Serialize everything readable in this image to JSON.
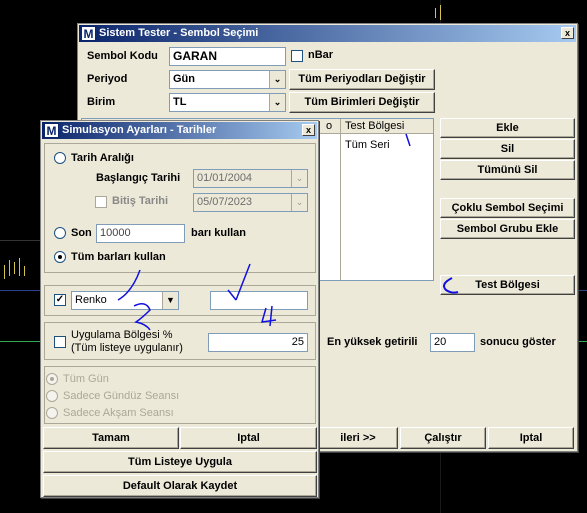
{
  "main_window": {
    "title": "Sistem Tester - Sembol Seçimi",
    "close": "x",
    "sembol_label": "Sembol Kodu",
    "sembol_value": "GARAN",
    "nbar_label": "nBar",
    "periyod_label": "Periyod",
    "periyod_value": "Gün",
    "tum_periyod_button": "Tüm Periyodları Değiştir",
    "birim_label": "Birim",
    "birim_value": "TL",
    "tum_birim_button": "Tüm Birimleri Değiştir",
    "grid_header_partial": "o",
    "grid_header": "Test Bölgesi",
    "grid_row": "Tüm Seri",
    "ekle_button": "Ekle",
    "sil_button": "Sil",
    "tumunu_sil_button": "Tümünü Sil",
    "coklu_button": "Çoklu Sembol Seçimi",
    "grup_button": "Sembol Grubu Ekle",
    "test_bolgesi_button": "Test Bölgesi",
    "en_yuksek_label": "En yüksek getirili",
    "en_yuksek_value": "20",
    "sonucu_label": "sonucu göster",
    "ileri_button": "ileri >>",
    "calistir_button": "Çalıştır",
    "iptal_button": "Iptal"
  },
  "sim_window": {
    "title": "Simulasyon Ayarları - Tarihler",
    "close": "x",
    "tarih_araligi": "Tarih Aralığı",
    "baslangic_label": "Başlangıç Tarihi",
    "baslangic_value": "01/01/2004",
    "bitis_label": "Bitiş Tarihi",
    "bitis_value": "05/07/2023",
    "son_label": "Son",
    "son_value": "10000",
    "bari_kullan": "barı kullan",
    "tum_barlari": "Tüm barları kullan",
    "renko_value": "Renko",
    "renko_param": "",
    "uygulama_label_1": "Uygulama Bölgesi  %",
    "uygulama_label_2": "(Tüm listeye uygulanır)",
    "uygulama_value": "25",
    "tum_gun": "Tüm Gün",
    "sadece_gunduz": "Sadece Gündüz Seansı",
    "sadece_aksam": "Sadece Akşam Seansı",
    "tamam_button": "Tamam",
    "iptal_button": "Iptal",
    "tum_listeye_button": "Tüm Listeye Uygula",
    "default_button": "Default Olarak Kaydet"
  },
  "annotations": {
    "n1": "1",
    "n2": "2",
    "n3": "3",
    "n4": "4"
  },
  "colors": {
    "titlebar": "#0a246a",
    "annotation": "#1010e0",
    "background": "#000000"
  }
}
